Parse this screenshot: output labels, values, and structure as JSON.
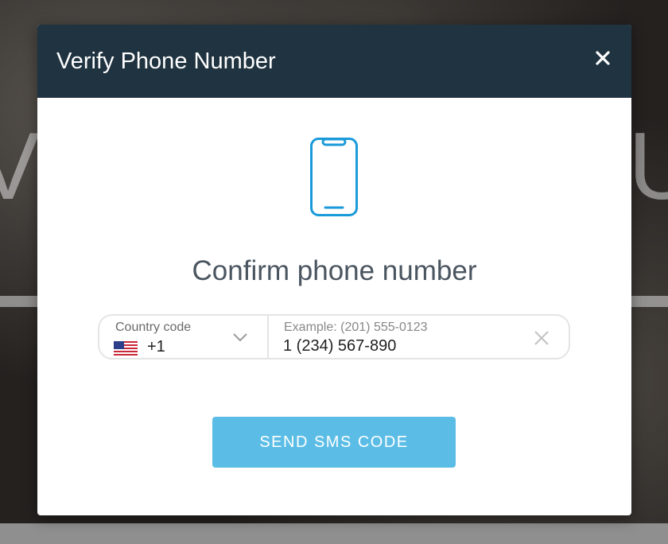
{
  "modal": {
    "title": "Verify Phone Number",
    "close_icon": "close-icon",
    "illustration_icon": "smartphone-icon",
    "heading": "Confirm phone number"
  },
  "phone_field": {
    "country_label": "Country code",
    "country_flag": "us-flag-icon",
    "dial_code": "+1",
    "number_placeholder": "Example: (201) 555-0123",
    "number_value": "1 (234) 567-890",
    "clear_icon": "clear-icon"
  },
  "actions": {
    "send_label": "SEND SMS CODE"
  },
  "colors": {
    "header": "#1f3340",
    "accent": "#5bbde6",
    "icon_blue": "#1a9ad9"
  }
}
